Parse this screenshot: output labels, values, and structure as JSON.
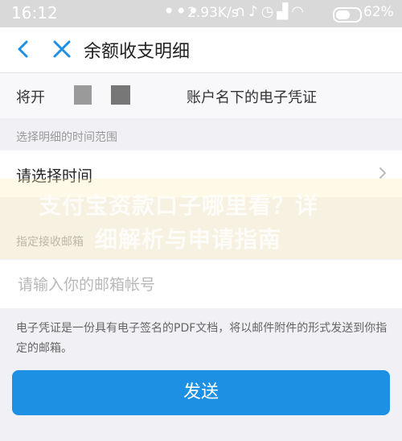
{
  "status_bar": {
    "time": "16:12",
    "dots": "•••",
    "net_speed": "2.93K/s",
    "icons": [
      "headset-icon",
      "mute-icon",
      "alarm-icon",
      "signal-icon",
      "wifi-icon",
      "battery-icon"
    ],
    "battery": "62%",
    "battery_level": 0.62
  },
  "nav": {
    "title": "余额收支明细"
  },
  "header": {
    "text_prefix": "将开",
    "text_suffix": "账户名下的电子凭证"
  },
  "time_section": {
    "label": "选择明细的时间范围",
    "placeholder": "请选择时间"
  },
  "email_section": {
    "label": "指定接收邮箱",
    "placeholder": "请输入你的邮箱帐号"
  },
  "hint": "电子凭证是一份具有电子签名的PDF文档，将以邮件附件的形式发送到你指定的邮箱。",
  "send_button": "发送",
  "watermark": {
    "line1": "支付宝资款口子哪里看？详",
    "line2": "细解析与申请指南"
  },
  "colors": {
    "accent": "#1e90e3",
    "status_bar_bg": "#d9d9d9",
    "page_bg": "#f1f1f5"
  }
}
